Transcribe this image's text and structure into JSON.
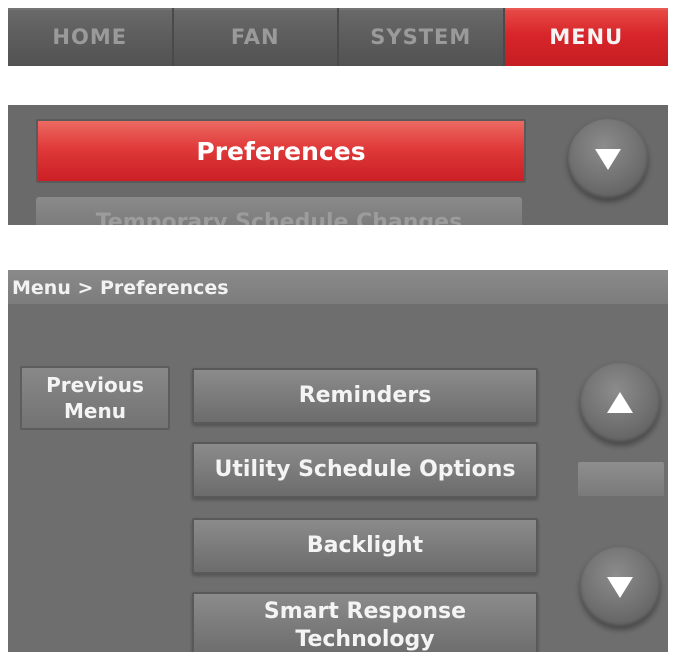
{
  "tabs": [
    {
      "label": "HOME",
      "active": false
    },
    {
      "label": "FAN",
      "active": false
    },
    {
      "label": "SYSTEM",
      "active": false
    },
    {
      "label": "MENU",
      "active": true
    }
  ],
  "preferences_strip": {
    "selected_item": "Preferences",
    "next_item_partial": "Temporary Schedule Changes"
  },
  "screen": {
    "breadcrumb": "Menu > Preferences",
    "previous_menu": {
      "line1": "Previous",
      "line2": "Menu"
    },
    "items": [
      {
        "line1": "Reminders",
        "line2": ""
      },
      {
        "line1": "Utility Schedule Options",
        "line2": ""
      },
      {
        "line1": "Backlight",
        "line2": ""
      },
      {
        "line1": "Smart Response",
        "line2": "Technology"
      }
    ]
  },
  "icons": {
    "scroll_up": "triangle-up-icon",
    "scroll_down": "triangle-down-icon"
  },
  "colors": {
    "accent_red": "#d8262b",
    "panel_gray": "#6d6d6d",
    "text_white": "#f4f4f4"
  }
}
